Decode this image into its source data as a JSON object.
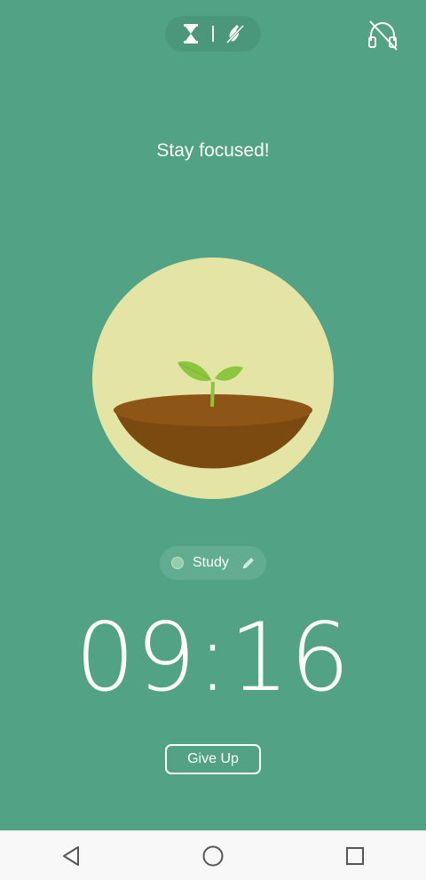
{
  "header": {
    "mode_timer_icon": "hourglass-icon",
    "mode_deep_focus_icon": "no-phone-icon",
    "sound_icon": "headphones-off-icon"
  },
  "main": {
    "headline": "Stay focused!",
    "tree_icon": "sapling-in-pot",
    "tag": {
      "label": "Study",
      "dot_color": "#92cfa8"
    },
    "timer": "09:16",
    "give_up_label": "Give Up"
  },
  "navbar": {
    "back_icon": "back-triangle-icon",
    "home_icon": "home-circle-icon",
    "recents_icon": "recents-square-icon"
  },
  "colors": {
    "background": "#52a386",
    "circle": "#e4e4a4",
    "soil_dark": "#7a4a10",
    "soil_top": "#8e5616",
    "leaf": "#8cc63e"
  }
}
